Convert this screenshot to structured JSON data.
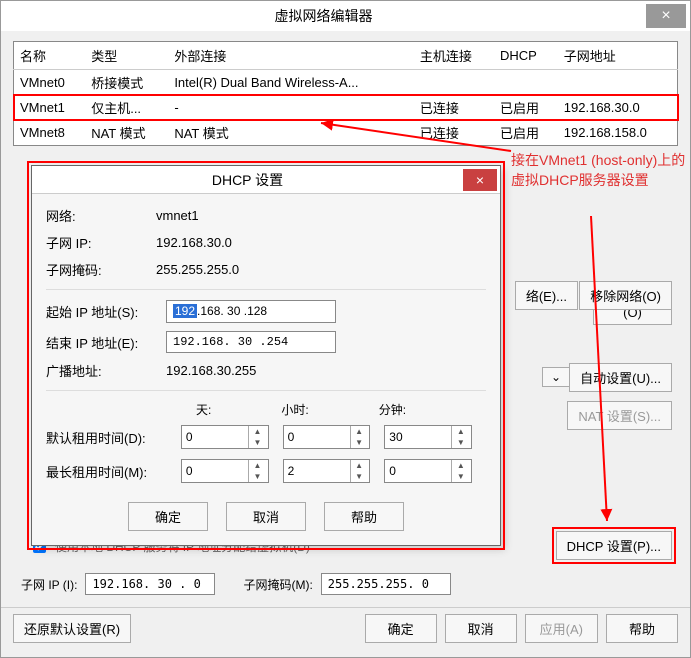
{
  "window": {
    "title": "虚拟网络编辑器",
    "close_x": "×"
  },
  "table": {
    "headers": {
      "name": "名称",
      "type": "类型",
      "external": "外部连接",
      "host": "主机连接",
      "dhcp": "DHCP",
      "subnet": "子网地址"
    },
    "rows": [
      {
        "name": "VMnet0",
        "type": "桥接模式",
        "external": "Intel(R) Dual Band Wireless-A...",
        "host": "",
        "dhcp": "",
        "subnet": ""
      },
      {
        "name": "VMnet1",
        "type": "仅主机...",
        "external": "-",
        "host": "已连接",
        "dhcp": "已启用",
        "subnet": "192.168.30.0"
      },
      {
        "name": "VMnet8",
        "type": "NAT 模式",
        "external": "NAT 模式",
        "host": "已连接",
        "dhcp": "已启用",
        "subnet": "192.168.158.0"
      }
    ]
  },
  "annotation_text": "接在VMnet1 (host-only)上的虚拟DHCP服务器设置",
  "right_buttons": {
    "add_net": "络(E)...",
    "remove_net": "移除网络(O)",
    "auto_set": "自动设置(U)...",
    "nat_set": "NAT 设置(S)...",
    "dhcp_set": "DHCP 设置(P)..."
  },
  "dropdown_arrow": "⌄",
  "checkbox_label": "使用本地 DHCP 服务将 IP 地址分配给虚拟机(D)",
  "subnet": {
    "ip_label": "子网 IP (I):",
    "ip_value": "192.168. 30 . 0",
    "mask_label": "子网掩码(M):",
    "mask_value": "255.255.255. 0"
  },
  "footer": {
    "restore": "还原默认设置(R)",
    "ok": "确定",
    "cancel": "取消",
    "apply": "应用(A)",
    "help": "帮助"
  },
  "dialog": {
    "title": "DHCP 设置",
    "close_x": "×",
    "net_label": "网络:",
    "net_val": "vmnet1",
    "subnet_label": "子网 IP:",
    "subnet_val": "192.168.30.0",
    "mask_label": "子网掩码:",
    "mask_val": "255.255.255.0",
    "start_label": "起始 IP 地址(S):",
    "start_sel": "192",
    "start_rest": ".168. 30 .128",
    "end_label": "结束 IP 地址(E):",
    "end_val": "192.168. 30 .254",
    "broadcast_label": "广播地址:",
    "broadcast_val": "192.168.30.255",
    "dur_header": {
      "days": "天:",
      "hours": "小时:",
      "minutes": "分钟:"
    },
    "default_lease_label": "默认租用时间(D):",
    "default_lease": {
      "days": "0",
      "hours": "0",
      "minutes": "30"
    },
    "max_lease_label": "最长租用时间(M):",
    "max_lease": {
      "days": "0",
      "hours": "2",
      "minutes": "0"
    },
    "ok": "确定",
    "cancel": "取消",
    "help": "帮助"
  }
}
